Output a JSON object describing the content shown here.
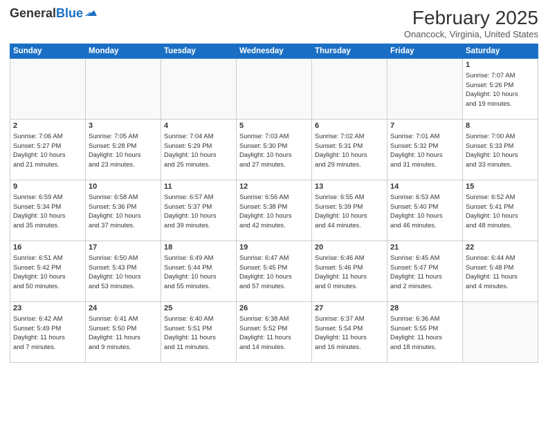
{
  "header": {
    "logo_general": "General",
    "logo_blue": "Blue",
    "month_title": "February 2025",
    "location": "Onancock, Virginia, United States"
  },
  "weekdays": [
    "Sunday",
    "Monday",
    "Tuesday",
    "Wednesday",
    "Thursday",
    "Friday",
    "Saturday"
  ],
  "weeks": [
    [
      {
        "day": "",
        "info": ""
      },
      {
        "day": "",
        "info": ""
      },
      {
        "day": "",
        "info": ""
      },
      {
        "day": "",
        "info": ""
      },
      {
        "day": "",
        "info": ""
      },
      {
        "day": "",
        "info": ""
      },
      {
        "day": "1",
        "info": "Sunrise: 7:07 AM\nSunset: 5:26 PM\nDaylight: 10 hours\nand 19 minutes."
      }
    ],
    [
      {
        "day": "2",
        "info": "Sunrise: 7:06 AM\nSunset: 5:27 PM\nDaylight: 10 hours\nand 21 minutes."
      },
      {
        "day": "3",
        "info": "Sunrise: 7:05 AM\nSunset: 5:28 PM\nDaylight: 10 hours\nand 23 minutes."
      },
      {
        "day": "4",
        "info": "Sunrise: 7:04 AM\nSunset: 5:29 PM\nDaylight: 10 hours\nand 25 minutes."
      },
      {
        "day": "5",
        "info": "Sunrise: 7:03 AM\nSunset: 5:30 PM\nDaylight: 10 hours\nand 27 minutes."
      },
      {
        "day": "6",
        "info": "Sunrise: 7:02 AM\nSunset: 5:31 PM\nDaylight: 10 hours\nand 29 minutes."
      },
      {
        "day": "7",
        "info": "Sunrise: 7:01 AM\nSunset: 5:32 PM\nDaylight: 10 hours\nand 31 minutes."
      },
      {
        "day": "8",
        "info": "Sunrise: 7:00 AM\nSunset: 5:33 PM\nDaylight: 10 hours\nand 33 minutes."
      }
    ],
    [
      {
        "day": "9",
        "info": "Sunrise: 6:59 AM\nSunset: 5:34 PM\nDaylight: 10 hours\nand 35 minutes."
      },
      {
        "day": "10",
        "info": "Sunrise: 6:58 AM\nSunset: 5:36 PM\nDaylight: 10 hours\nand 37 minutes."
      },
      {
        "day": "11",
        "info": "Sunrise: 6:57 AM\nSunset: 5:37 PM\nDaylight: 10 hours\nand 39 minutes."
      },
      {
        "day": "12",
        "info": "Sunrise: 6:56 AM\nSunset: 5:38 PM\nDaylight: 10 hours\nand 42 minutes."
      },
      {
        "day": "13",
        "info": "Sunrise: 6:55 AM\nSunset: 5:39 PM\nDaylight: 10 hours\nand 44 minutes."
      },
      {
        "day": "14",
        "info": "Sunrise: 6:53 AM\nSunset: 5:40 PM\nDaylight: 10 hours\nand 46 minutes."
      },
      {
        "day": "15",
        "info": "Sunrise: 6:52 AM\nSunset: 5:41 PM\nDaylight: 10 hours\nand 48 minutes."
      }
    ],
    [
      {
        "day": "16",
        "info": "Sunrise: 6:51 AM\nSunset: 5:42 PM\nDaylight: 10 hours\nand 50 minutes."
      },
      {
        "day": "17",
        "info": "Sunrise: 6:50 AM\nSunset: 5:43 PM\nDaylight: 10 hours\nand 53 minutes."
      },
      {
        "day": "18",
        "info": "Sunrise: 6:49 AM\nSunset: 5:44 PM\nDaylight: 10 hours\nand 55 minutes."
      },
      {
        "day": "19",
        "info": "Sunrise: 6:47 AM\nSunset: 5:45 PM\nDaylight: 10 hours\nand 57 minutes."
      },
      {
        "day": "20",
        "info": "Sunrise: 6:46 AM\nSunset: 5:46 PM\nDaylight: 11 hours\nand 0 minutes."
      },
      {
        "day": "21",
        "info": "Sunrise: 6:45 AM\nSunset: 5:47 PM\nDaylight: 11 hours\nand 2 minutes."
      },
      {
        "day": "22",
        "info": "Sunrise: 6:44 AM\nSunset: 5:48 PM\nDaylight: 11 hours\nand 4 minutes."
      }
    ],
    [
      {
        "day": "23",
        "info": "Sunrise: 6:42 AM\nSunset: 5:49 PM\nDaylight: 11 hours\nand 7 minutes."
      },
      {
        "day": "24",
        "info": "Sunrise: 6:41 AM\nSunset: 5:50 PM\nDaylight: 11 hours\nand 9 minutes."
      },
      {
        "day": "25",
        "info": "Sunrise: 6:40 AM\nSunset: 5:51 PM\nDaylight: 11 hours\nand 11 minutes."
      },
      {
        "day": "26",
        "info": "Sunrise: 6:38 AM\nSunset: 5:52 PM\nDaylight: 11 hours\nand 14 minutes."
      },
      {
        "day": "27",
        "info": "Sunrise: 6:37 AM\nSunset: 5:54 PM\nDaylight: 11 hours\nand 16 minutes."
      },
      {
        "day": "28",
        "info": "Sunrise: 6:36 AM\nSunset: 5:55 PM\nDaylight: 11 hours\nand 18 minutes."
      },
      {
        "day": "",
        "info": ""
      }
    ]
  ]
}
